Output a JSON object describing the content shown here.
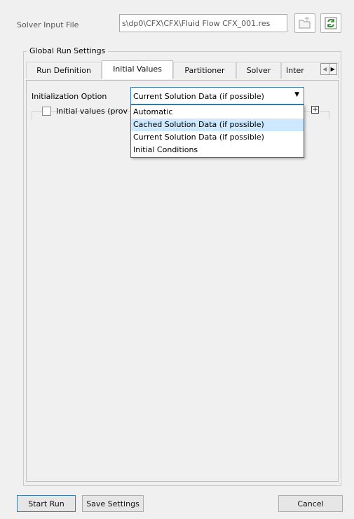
{
  "solver_input": {
    "label": "Solver Input File",
    "value": "s\\dp0\\CFX\\CFX\\Fluid Flow CFX_001.res"
  },
  "global_run_settings": {
    "title": "Global Run Settings",
    "tabs": [
      {
        "label": "Run Definition",
        "active": false
      },
      {
        "label": "Initial Values",
        "active": true
      },
      {
        "label": "Partitioner",
        "active": false
      },
      {
        "label": "Solver",
        "active": false
      },
      {
        "label": "Inter",
        "active": false
      }
    ]
  },
  "initial_values": {
    "init_option_label": "Initialization Option",
    "init_option_value": "Current Solution Data (if possible)",
    "checkbox_label": "Initial values (prov",
    "dropdown_options": [
      {
        "label": "Automatic",
        "highlighted": false
      },
      {
        "label": "Cached Solution Data (if possible)",
        "highlighted": true
      },
      {
        "label": "Current Solution Data (if possible)",
        "highlighted": false
      },
      {
        "label": "Initial Conditions",
        "highlighted": false
      }
    ]
  },
  "footer": {
    "start_run": "Start Run",
    "save_settings": "Save Settings",
    "cancel": "Cancel"
  },
  "colors": {
    "accent": "#3c7fb1",
    "highlight": "#cde8ff",
    "refresh_icon": "#2f8a2f"
  }
}
